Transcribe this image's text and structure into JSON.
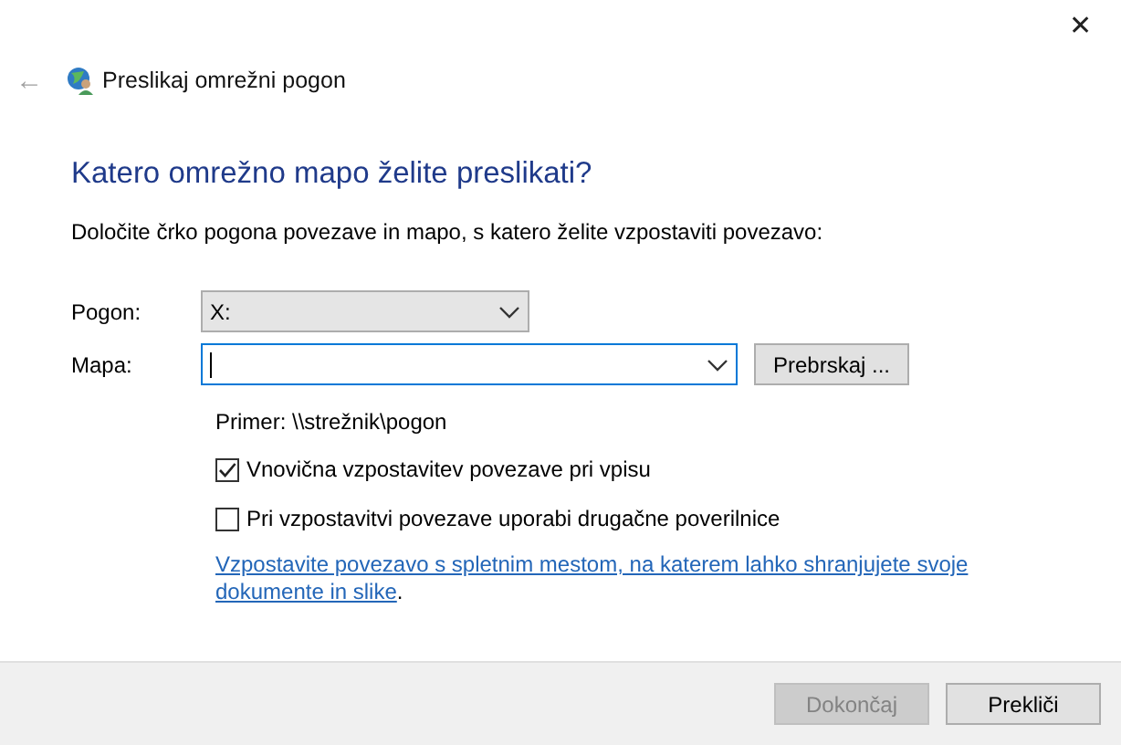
{
  "window": {
    "title": "Preslikaj omrežni pogon",
    "close": "✕",
    "back": "←"
  },
  "heading": "Katero omrežno mapo želite preslikati?",
  "description": "Določite črko pogona povezave in mapo, s katero želite vzpostaviti povezavo:",
  "drive": {
    "label": "Pogon:",
    "value": "X:"
  },
  "folder": {
    "label": "Mapa:",
    "focused": true
  },
  "browse_button": "Prebrskaj ...",
  "example": "Primer: \\\\strežnik\\pogon",
  "options": [
    {
      "label": "Vnovična vzpostavitev povezave pri vpisu",
      "checked": true
    },
    {
      "label": "Pri vzpostavitvi povezave uporabi drugačne poverilnice",
      "checked": false
    }
  ],
  "link": {
    "text": "Vzpostavite povezavo s spletnim mestom, na katerem lahko shranjujete svoje dokumente in slike",
    "suffix": "."
  },
  "buttons": [
    {
      "label": "Dokončaj",
      "disabled": true
    },
    {
      "label": "Prekliči",
      "disabled": false
    }
  ]
}
